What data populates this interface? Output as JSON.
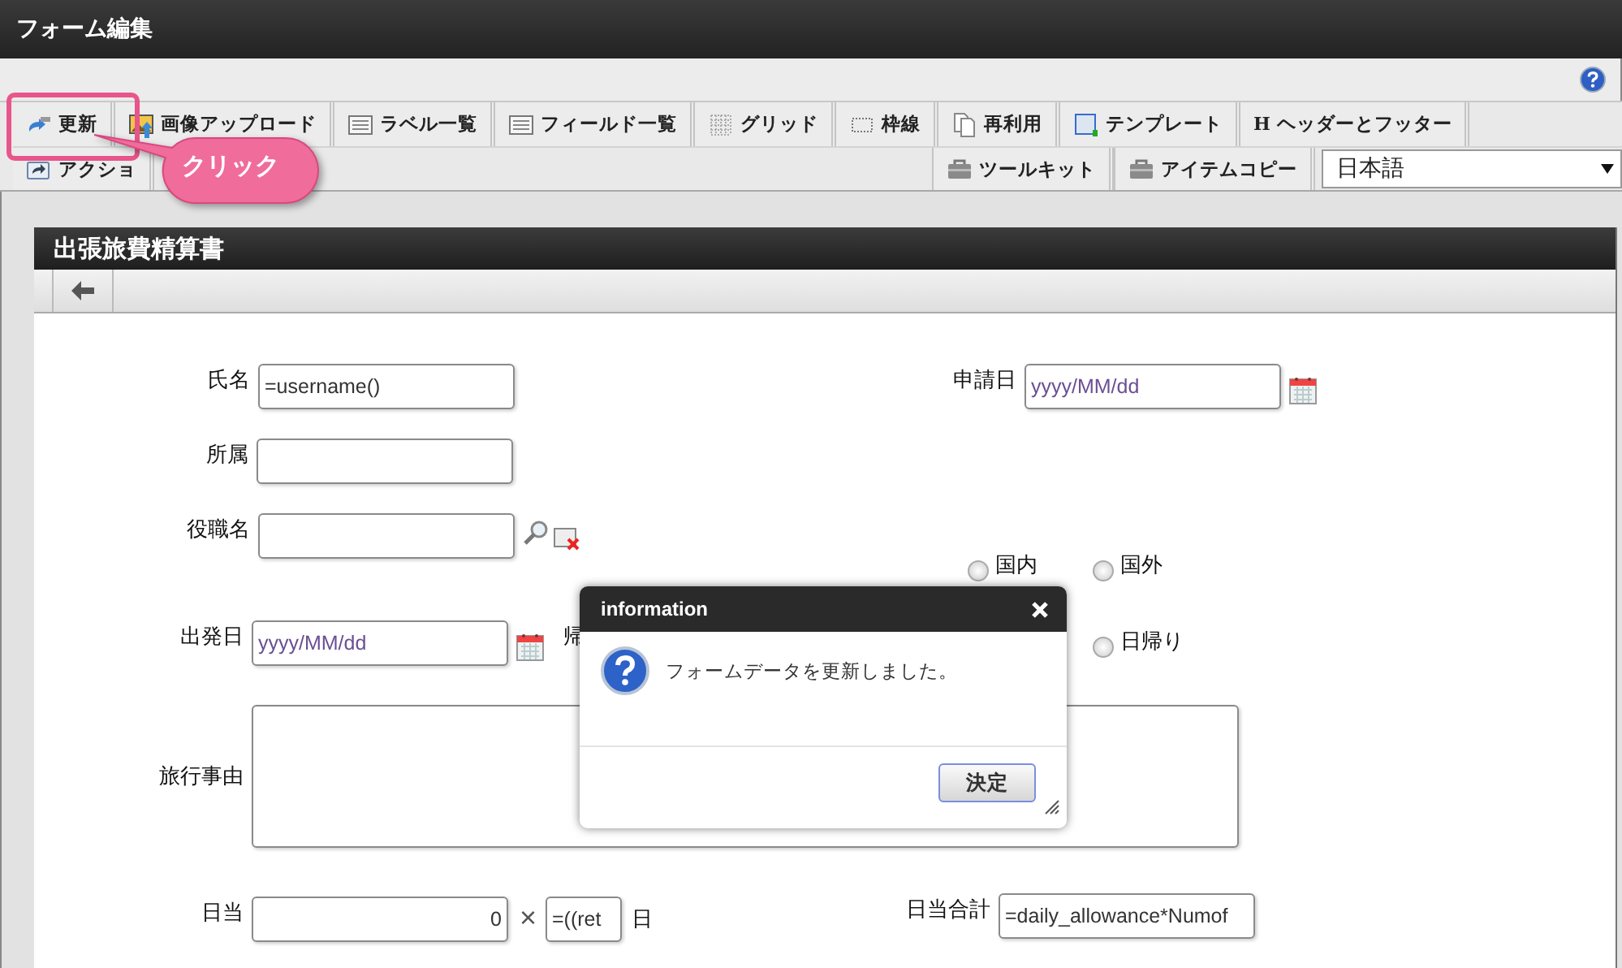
{
  "window": {
    "title": "フォーム編集"
  },
  "tabs": [
    {
      "label": "更新"
    },
    {
      "label": "画像アップロード"
    },
    {
      "label": "ラベル一覧"
    },
    {
      "label": "フィールド一覧"
    },
    {
      "label": "グリッド"
    },
    {
      "label": "枠線"
    },
    {
      "label": "再利用"
    },
    {
      "label": "テンプレート"
    },
    {
      "label": "ヘッダーとフッター",
      "glyph": "H"
    }
  ],
  "tabs_row2_left": [
    {
      "label": "アクショ"
    }
  ],
  "tabs_row2_right": [
    {
      "label": "ツールキット"
    },
    {
      "label": "アイテムコピー"
    }
  ],
  "language_select": {
    "value": "日本語"
  },
  "callout": {
    "text": "クリック"
  },
  "form": {
    "title": "出張旅費精算書",
    "fields": [
      {
        "kind": "text",
        "label": "氏名",
        "value": "=username()"
      },
      {
        "kind": "text",
        "label": "所属"
      },
      {
        "kind": "lookup",
        "label": "役職名"
      },
      {
        "kind": "date",
        "label": "申請日",
        "placeholder": "yyyy/MM/dd"
      },
      {
        "kind": "radio",
        "options": [
          {
            "label": "国内",
            "selected": false
          },
          {
            "label": "国外",
            "selected": false
          }
        ]
      },
      {
        "kind": "date",
        "label": "出発日",
        "placeholder": "yyyy/MM/dd"
      },
      {
        "kind": "label",
        "text": "帰"
      },
      {
        "kind": "radio",
        "options": [
          {
            "label": "日帰り",
            "selected": false
          }
        ]
      },
      {
        "kind": "textarea",
        "label": "旅行事由"
      },
      {
        "kind": "number",
        "label": "日当",
        "value": "0"
      },
      {
        "kind": "sign",
        "text": "×"
      },
      {
        "kind": "text",
        "value": "=((ret",
        "suffix": "日"
      },
      {
        "kind": "text",
        "label": "日当合計",
        "value": "=daily_allowance*Numof"
      }
    ]
  },
  "dialog": {
    "title": "information",
    "message": "フォームデータを更新しました。",
    "button": "決定"
  }
}
